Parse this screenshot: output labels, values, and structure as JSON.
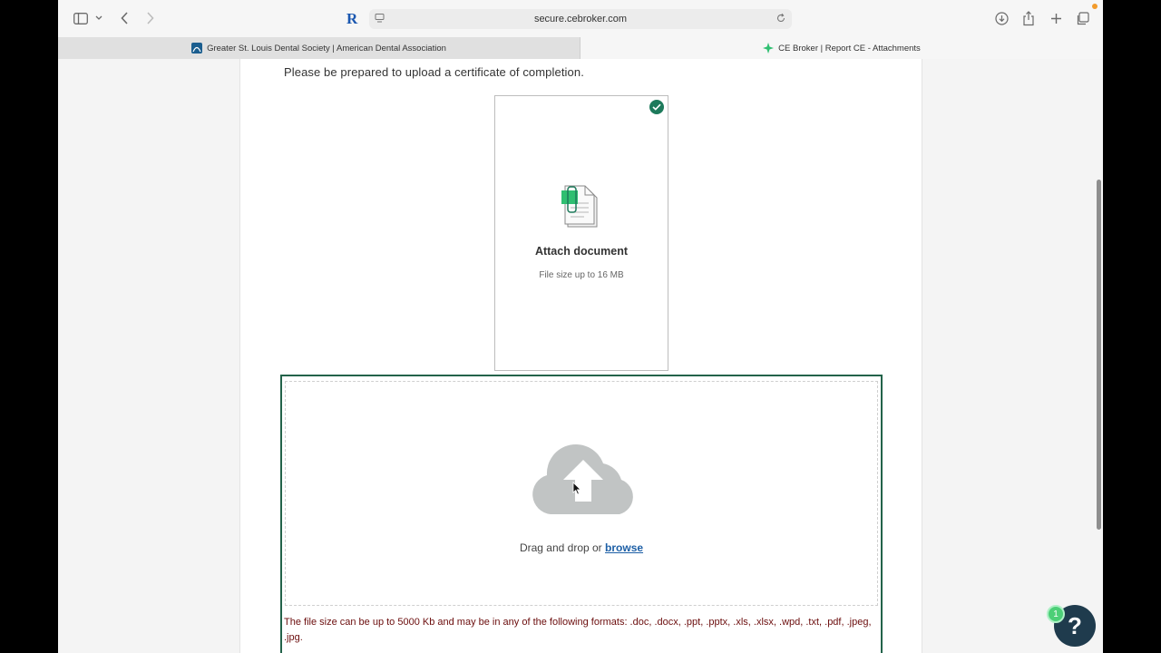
{
  "browser": {
    "url": "secure.cebroker.com",
    "tabs": [
      {
        "label": "Greater St. Louis Dental Society | American Dental Association",
        "active": false
      },
      {
        "label": "CE Broker | Report CE - Attachments",
        "active": true
      }
    ],
    "extension_letter": "R"
  },
  "page": {
    "instruction": "Please be prepared to upload a certificate of completion.",
    "attach_card": {
      "title": "Attach document",
      "subtitle": "File size up to 16 MB"
    },
    "dropzone": {
      "prompt": "Drag and drop or",
      "browse_label": "browse",
      "note": "The file size can be up to 5000 Kb and may be in any of the following formats: .doc, .docx, .ppt, .pptx, .xls, .xlsx, .wpd, .txt, .pdf, .jpeg, .jpg."
    },
    "help": {
      "label": "?",
      "badge_count": "1"
    }
  },
  "colors": {
    "accent_green": "#23634a",
    "check_green": "#1d7a5b",
    "link_blue": "#1d5fa6",
    "note_red": "#6b0d0d",
    "help_navy": "#1f3b4d"
  }
}
